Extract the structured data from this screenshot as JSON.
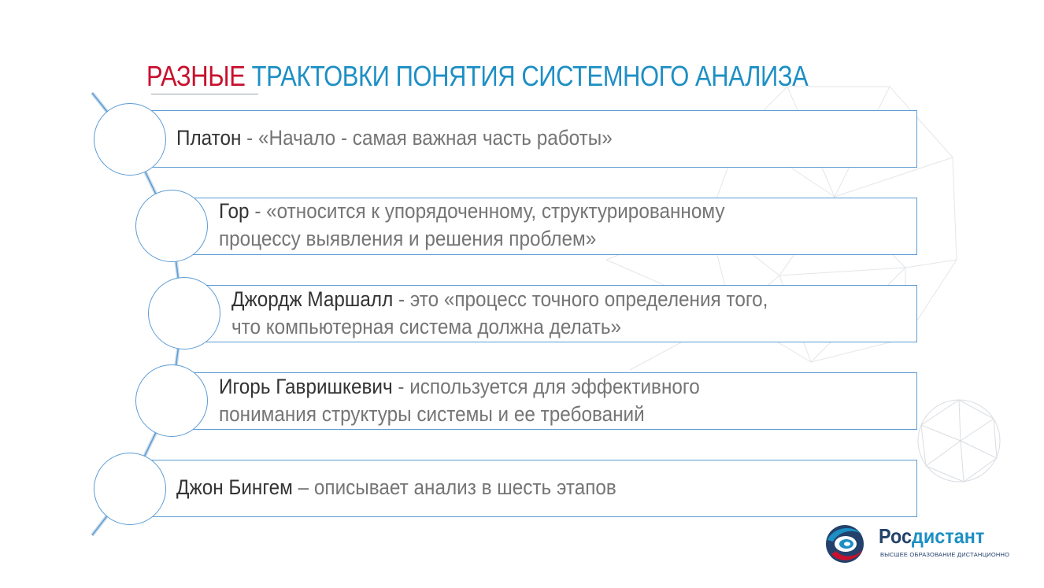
{
  "title": {
    "accent": "РАЗНЫЕ",
    "rest": " ТРАКТОВКИ ПОНЯТИЯ СИСТЕМНОГО АНАЛИЗА"
  },
  "items": [
    {
      "author": "Платон",
      "lines": [
        " - «Начало - самая важная часть работы»"
      ]
    },
    {
      "author": "Гор",
      "lines": [
        " - «относится к упорядоченному, структурированному",
        "процессу выявления и решения проблем»"
      ]
    },
    {
      "author": "Джордж Маршалл",
      "lines": [
        " - это «процесс точного определения того,",
        "что компьютерная система должна делать»"
      ]
    },
    {
      "author": "Игорь Гавришкевич",
      "lines": [
        " - используется для эффективного",
        "понимания структуры системы и ее требований"
      ]
    },
    {
      "author": "Джон Бингем",
      "lines": [
        " – описывает анализ в шесть этапов"
      ]
    }
  ],
  "logo": {
    "name_part1": "Рос",
    "name_part2": "дистант",
    "tagline": "ВЫСШЕЕ ОБРАЗОВАНИЕ ДИСТАНЦИОННО"
  },
  "colors": {
    "accent_red": "#c8102e",
    "title_blue": "#1d8fc4",
    "outline_blue": "#5b9bd5",
    "author_text": "#333333",
    "body_text": "#757575",
    "logo_navy": "#23416b"
  }
}
